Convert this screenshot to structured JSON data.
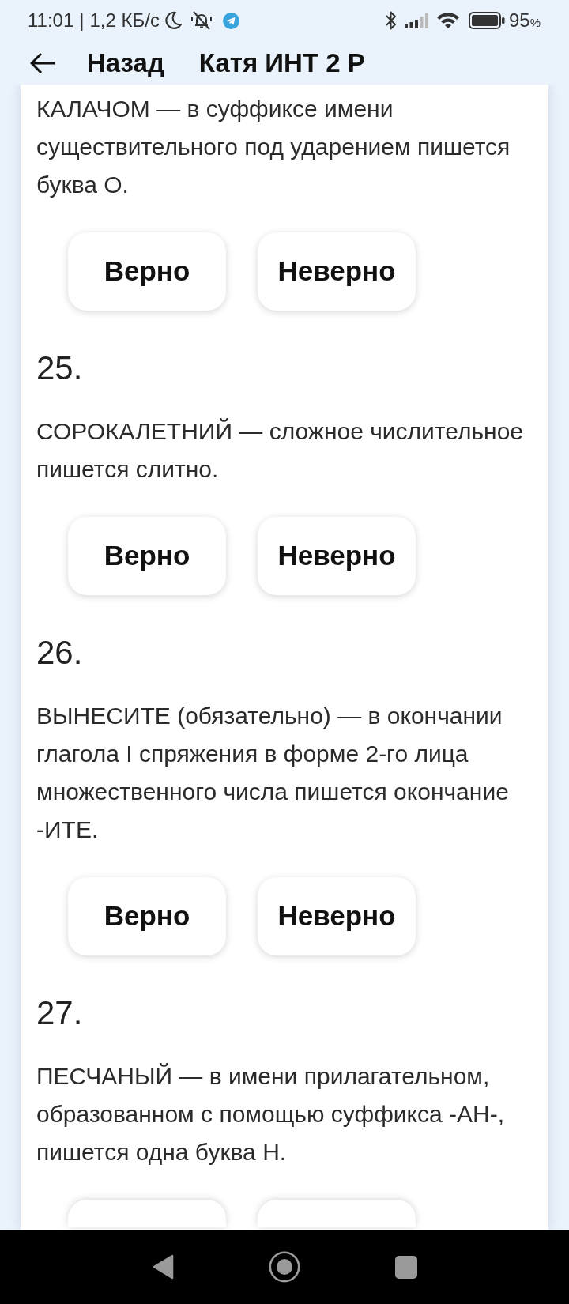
{
  "status_bar": {
    "time": "11:01",
    "separator": "|",
    "net_speed": "1,2 КБ/с",
    "battery_percent": "95",
    "battery_unit": "%"
  },
  "header": {
    "back_label": "Назад",
    "title": "Катя ИНТ 2 Р"
  },
  "questions": [
    {
      "text": "КАЛАЧОМ — в суффиксе имени существительного под ударением пишется буква О.",
      "answers": [
        {
          "kind": "labeled",
          "label": "Верно"
        },
        {
          "kind": "labeled",
          "label": "Неверно"
        }
      ]
    },
    {
      "number": "25.",
      "text": "СОРОКАЛЕТНИЙ — сложное числительное пишется слитно.",
      "answers": [
        {
          "kind": "labeled",
          "label": "Верно"
        },
        {
          "kind": "labeled",
          "label": "Неверно"
        }
      ]
    },
    {
      "number": "26.",
      "text": "ВЫНЕСИТЕ (обязательно) — в окончании глагола I спряжения в форме 2-го лица множественного числа пишется окончание -ИТЕ.",
      "answers": [
        {
          "kind": "labeled",
          "label": "Верно"
        },
        {
          "kind": "labeled",
          "label": "Неверно"
        }
      ]
    },
    {
      "number": "27.",
      "text": "ПЕСЧАНЫЙ — в имени прилагательном, образованном с помощью суффикса -АН-, пишется одна буква Н.",
      "answers": [
        {
          "kind": "cut_off"
        },
        {
          "kind": "cut_off"
        }
      ]
    }
  ]
}
